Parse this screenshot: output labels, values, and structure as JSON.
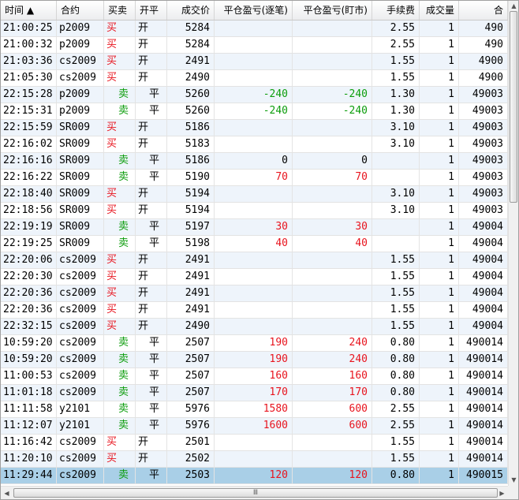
{
  "columns": [
    {
      "key": "time",
      "label": "时间 ▲",
      "align": "l",
      "w": 71
    },
    {
      "key": "contract",
      "label": "合约",
      "align": "l",
      "w": 60
    },
    {
      "key": "side",
      "label": "买卖",
      "align": "l",
      "w": 40
    },
    {
      "key": "oc",
      "label": "开平",
      "align": "l",
      "w": 40
    },
    {
      "key": "price",
      "label": "成交价",
      "align": "r",
      "w": 60
    },
    {
      "key": "pnl_trade",
      "label": "平仓盈亏(逐笔)",
      "align": "r",
      "w": 99
    },
    {
      "key": "pnl_mkt",
      "label": "平仓盈亏(盯市)",
      "align": "r",
      "w": 101
    },
    {
      "key": "fee",
      "label": "手续费",
      "align": "r",
      "w": 60
    },
    {
      "key": "qty",
      "label": "成交量",
      "align": "r",
      "w": 50
    },
    {
      "key": "other",
      "label": "合",
      "align": "r",
      "w": 62
    }
  ],
  "rows": [
    {
      "time": "21:00:25",
      "contract": "p2009",
      "side": "买",
      "oc": "开",
      "price": "5284",
      "pnl_trade": "",
      "pnl_mkt": "",
      "fee": "2.55",
      "qty": "1",
      "other": "490"
    },
    {
      "time": "21:00:32",
      "contract": "p2009",
      "side": "买",
      "oc": "开",
      "price": "5284",
      "pnl_trade": "",
      "pnl_mkt": "",
      "fee": "2.55",
      "qty": "1",
      "other": "490"
    },
    {
      "time": "21:03:36",
      "contract": "cs2009",
      "side": "买",
      "oc": "开",
      "price": "2491",
      "pnl_trade": "",
      "pnl_mkt": "",
      "fee": "1.55",
      "qty": "1",
      "other": "4900"
    },
    {
      "time": "21:05:30",
      "contract": "cs2009",
      "side": "买",
      "oc": "开",
      "price": "2490",
      "pnl_trade": "",
      "pnl_mkt": "",
      "fee": "1.55",
      "qty": "1",
      "other": "4900"
    },
    {
      "time": "22:15:28",
      "contract": "p2009",
      "side": "卖",
      "oc": "平",
      "price": "5260",
      "pnl_trade": "-240",
      "pnl_mkt": "-240",
      "fee": "1.30",
      "qty": "1",
      "other": "49003"
    },
    {
      "time": "22:15:31",
      "contract": "p2009",
      "side": "卖",
      "oc": "平",
      "price": "5260",
      "pnl_trade": "-240",
      "pnl_mkt": "-240",
      "fee": "1.30",
      "qty": "1",
      "other": "49003"
    },
    {
      "time": "22:15:59",
      "contract": "SR009",
      "side": "买",
      "oc": "开",
      "price": "5186",
      "pnl_trade": "",
      "pnl_mkt": "",
      "fee": "3.10",
      "qty": "1",
      "other": "49003"
    },
    {
      "time": "22:16:02",
      "contract": "SR009",
      "side": "买",
      "oc": "开",
      "price": "5183",
      "pnl_trade": "",
      "pnl_mkt": "",
      "fee": "3.10",
      "qty": "1",
      "other": "49003"
    },
    {
      "time": "22:16:16",
      "contract": "SR009",
      "side": "卖",
      "oc": "平",
      "price": "5186",
      "pnl_trade": "0",
      "pnl_mkt": "0",
      "fee": "",
      "qty": "1",
      "other": "49003"
    },
    {
      "time": "22:16:22",
      "contract": "SR009",
      "side": "卖",
      "oc": "平",
      "price": "5190",
      "pnl_trade": "70",
      "pnl_mkt": "70",
      "fee": "",
      "qty": "1",
      "other": "49003"
    },
    {
      "time": "22:18:40",
      "contract": "SR009",
      "side": "买",
      "oc": "开",
      "price": "5194",
      "pnl_trade": "",
      "pnl_mkt": "",
      "fee": "3.10",
      "qty": "1",
      "other": "49003"
    },
    {
      "time": "22:18:56",
      "contract": "SR009",
      "side": "买",
      "oc": "开",
      "price": "5194",
      "pnl_trade": "",
      "pnl_mkt": "",
      "fee": "3.10",
      "qty": "1",
      "other": "49003"
    },
    {
      "time": "22:19:19",
      "contract": "SR009",
      "side": "卖",
      "oc": "平",
      "price": "5197",
      "pnl_trade": "30",
      "pnl_mkt": "30",
      "fee": "",
      "qty": "1",
      "other": "49004"
    },
    {
      "time": "22:19:25",
      "contract": "SR009",
      "side": "卖",
      "oc": "平",
      "price": "5198",
      "pnl_trade": "40",
      "pnl_mkt": "40",
      "fee": "",
      "qty": "1",
      "other": "49004"
    },
    {
      "time": "22:20:06",
      "contract": "cs2009",
      "side": "买",
      "oc": "开",
      "price": "2491",
      "pnl_trade": "",
      "pnl_mkt": "",
      "fee": "1.55",
      "qty": "1",
      "other": "49004"
    },
    {
      "time": "22:20:30",
      "contract": "cs2009",
      "side": "买",
      "oc": "开",
      "price": "2491",
      "pnl_trade": "",
      "pnl_mkt": "",
      "fee": "1.55",
      "qty": "1",
      "other": "49004"
    },
    {
      "time": "22:20:36",
      "contract": "cs2009",
      "side": "买",
      "oc": "开",
      "price": "2491",
      "pnl_trade": "",
      "pnl_mkt": "",
      "fee": "1.55",
      "qty": "1",
      "other": "49004"
    },
    {
      "time": "22:20:36",
      "contract": "cs2009",
      "side": "买",
      "oc": "开",
      "price": "2491",
      "pnl_trade": "",
      "pnl_mkt": "",
      "fee": "1.55",
      "qty": "1",
      "other": "49004"
    },
    {
      "time": "22:32:15",
      "contract": "cs2009",
      "side": "买",
      "oc": "开",
      "price": "2490",
      "pnl_trade": "",
      "pnl_mkt": "",
      "fee": "1.55",
      "qty": "1",
      "other": "49004"
    },
    {
      "time": "10:59:20",
      "contract": "cs2009",
      "side": "卖",
      "oc": "平",
      "price": "2507",
      "pnl_trade": "190",
      "pnl_mkt": "240",
      "fee": "0.80",
      "qty": "1",
      "other": "490014"
    },
    {
      "time": "10:59:20",
      "contract": "cs2009",
      "side": "卖",
      "oc": "平",
      "price": "2507",
      "pnl_trade": "190",
      "pnl_mkt": "240",
      "fee": "0.80",
      "qty": "1",
      "other": "490014"
    },
    {
      "time": "11:00:53",
      "contract": "cs2009",
      "side": "卖",
      "oc": "平",
      "price": "2507",
      "pnl_trade": "160",
      "pnl_mkt": "160",
      "fee": "0.80",
      "qty": "1",
      "other": "490014"
    },
    {
      "time": "11:01:18",
      "contract": "cs2009",
      "side": "卖",
      "oc": "平",
      "price": "2507",
      "pnl_trade": "170",
      "pnl_mkt": "170",
      "fee": "0.80",
      "qty": "1",
      "other": "490014"
    },
    {
      "time": "11:11:58",
      "contract": "y2101",
      "side": "卖",
      "oc": "平",
      "price": "5976",
      "pnl_trade": "1580",
      "pnl_mkt": "600",
      "fee": "2.55",
      "qty": "1",
      "other": "490014"
    },
    {
      "time": "11:12:07",
      "contract": "y2101",
      "side": "卖",
      "oc": "平",
      "price": "5976",
      "pnl_trade": "1600",
      "pnl_mkt": "600",
      "fee": "2.55",
      "qty": "1",
      "other": "490014"
    },
    {
      "time": "11:16:42",
      "contract": "cs2009",
      "side": "买",
      "oc": "开",
      "price": "2501",
      "pnl_trade": "",
      "pnl_mkt": "",
      "fee": "1.55",
      "qty": "1",
      "other": "490014"
    },
    {
      "time": "11:20:10",
      "contract": "cs2009",
      "side": "买",
      "oc": "开",
      "price": "2502",
      "pnl_trade": "",
      "pnl_mkt": "",
      "fee": "1.55",
      "qty": "1",
      "other": "490014"
    },
    {
      "time": "11:29:44",
      "contract": "cs2009",
      "side": "卖",
      "oc": "平",
      "price": "2503",
      "pnl_trade": "120",
      "pnl_mkt": "120",
      "fee": "0.80",
      "qty": "1",
      "other": "490015"
    }
  ],
  "selected_row": 27,
  "colors": {
    "buy": "#e8141e",
    "sell": "#0c9d0c",
    "selection": "#a9cfe7",
    "alt_row": "#eef4fb"
  },
  "scroll": {
    "hthumb_label": "Ⅲ",
    "up_icon": "▲",
    "down_icon": "▼",
    "left_icon": "◀",
    "right_icon": "▶"
  }
}
